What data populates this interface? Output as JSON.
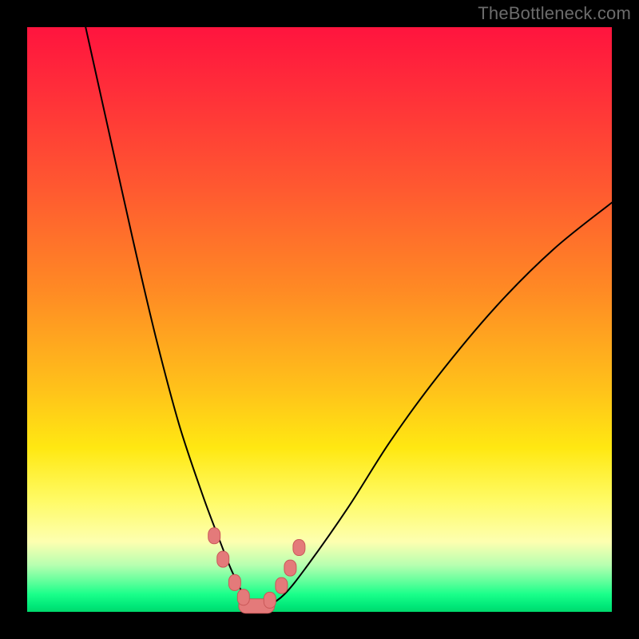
{
  "watermark": "TheBottleneck.com",
  "chart_data": {
    "type": "line",
    "title": "",
    "xlabel": "",
    "ylabel": "",
    "xlim": [
      0,
      100
    ],
    "ylim": [
      0,
      100
    ],
    "series": [
      {
        "name": "bottleneck-curve",
        "x": [
          10,
          14,
          18,
          22,
          26,
          30,
          33,
          35,
          37,
          39,
          41,
          44,
          48,
          55,
          62,
          70,
          80,
          90,
          100
        ],
        "y": [
          100,
          82,
          64,
          47,
          32,
          20,
          12,
          7,
          3,
          1,
          1,
          3,
          8,
          18,
          29,
          40,
          52,
          62,
          70
        ]
      }
    ],
    "markers": {
      "name": "highlight-points",
      "x": [
        32,
        33.5,
        35.5,
        37,
        38.5,
        40,
        41.5,
        43.5,
        45,
        46.5
      ],
      "y": [
        13,
        9,
        5,
        2.5,
        1,
        1,
        2,
        4.5,
        7.5,
        11
      ]
    },
    "annotations": []
  },
  "colors": {
    "gradient_top": "#ff143e",
    "gradient_mid": "#ffe812",
    "gradient_bottom": "#00d86c",
    "marker": "#e47a7a",
    "curve": "#000000",
    "frame": "#000000"
  }
}
